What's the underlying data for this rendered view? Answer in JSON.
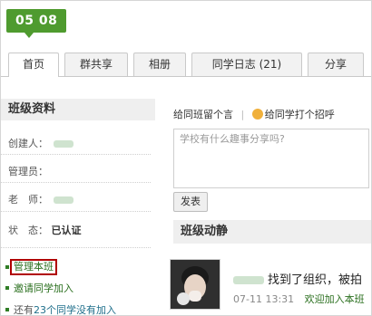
{
  "class_badge": "05 08",
  "tabs": [
    {
      "label": "首页",
      "active": true
    },
    {
      "label": "群共享",
      "active": false
    },
    {
      "label": "相册",
      "active": false
    },
    {
      "label": "同学日志 (21)",
      "active": false
    },
    {
      "label": "分享",
      "active": false
    }
  ],
  "sidebar": {
    "title": "班级资料",
    "fields": [
      {
        "label": "创建人："
      },
      {
        "label": "管理员："
      },
      {
        "label": "老　师："
      },
      {
        "label": "状　态：",
        "value": "已认证"
      }
    ],
    "manage_link": "管理本班",
    "invite_link": "邀请同学加入",
    "remaining_prefix": "还有",
    "remaining_count": "23个同学没有加入"
  },
  "post": {
    "tab_message": "给同班留个言",
    "tab_greet": "给同学打个招呼",
    "placeholder": "学校有什么趣事分享吗?",
    "submit_label": "发表"
  },
  "feed": {
    "title": "班级动静",
    "item": {
      "text": "找到了组织，被拍",
      "time": "07-11 13:31",
      "action": "欢迎加入本班"
    }
  },
  "colors": {
    "accent_green": "#4f9b2f",
    "link_blue": "#1f6f8b",
    "highlight_red": "#b00000"
  }
}
